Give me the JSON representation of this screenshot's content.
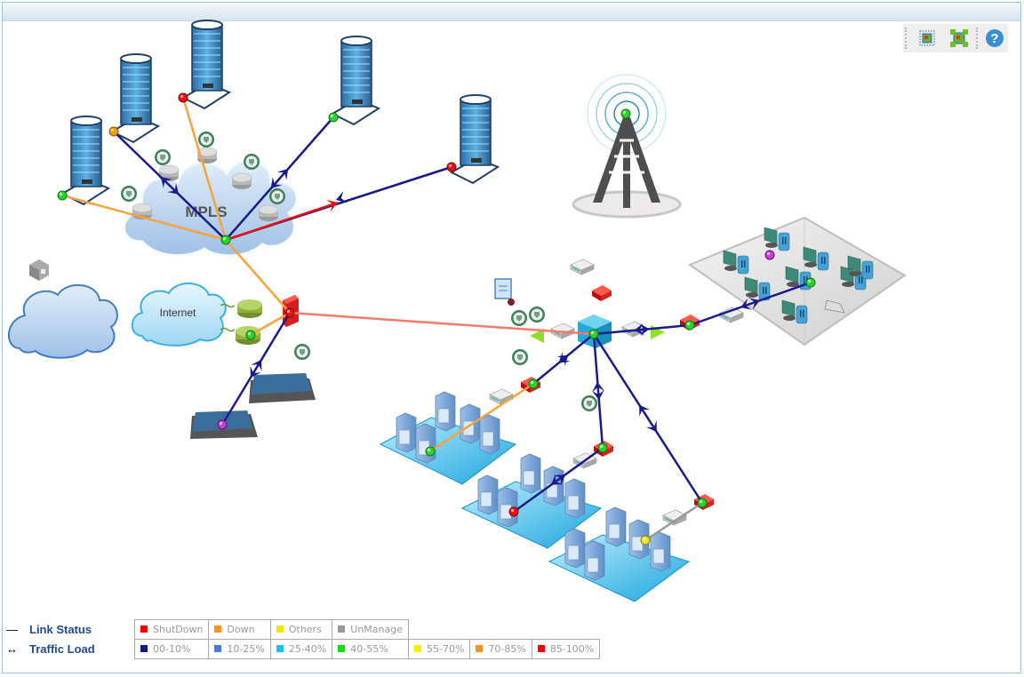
{
  "toolbar": {
    "buttons": [
      {
        "name": "fit-to-view",
        "icon": "fit-view-icon"
      },
      {
        "name": "fullscreen",
        "icon": "expand-view-icon"
      },
      {
        "name": "help",
        "icon": "help-icon",
        "glyph": "?"
      }
    ]
  },
  "map": {
    "clouds": [
      {
        "id": "mpls",
        "label": "MPLS"
      },
      {
        "id": "internet",
        "label": "Internet"
      },
      {
        "id": "unnamed-cloud",
        "label": ""
      }
    ]
  },
  "legend": {
    "link_status": {
      "symbol": "—",
      "label": "Link Status",
      "items": [
        {
          "label": "ShutDown",
          "color": "#ff0000"
        },
        {
          "label": "Down",
          "color": "#f7931e"
        },
        {
          "label": "Others",
          "color": "#f0e800"
        },
        {
          "label": "UnManage",
          "color": "#999999"
        }
      ]
    },
    "traffic_load": {
      "symbol": "↔",
      "label": "Traffic Load",
      "items": [
        {
          "label": "00-10%",
          "color": "#101a8c"
        },
        {
          "label": "10-25%",
          "color": "#4a7bdb"
        },
        {
          "label": "25-40%",
          "color": "#1ec0f0"
        },
        {
          "label": "40-55%",
          "color": "#10e010"
        },
        {
          "label": "55-70%",
          "color": "#f0f000"
        },
        {
          "label": "70-85%",
          "color": "#f7931e"
        },
        {
          "label": "85-100%",
          "color": "#ff0000"
        }
      ]
    }
  },
  "colors": {
    "low_traffic": "#1a1a8c",
    "down": "#f7a23e",
    "high_traffic": "#ee1111",
    "salmon_link": "#f77a6a",
    "unmanaged": "#9a9a9a",
    "status_up": "#22cc22",
    "status_down": "#f39c12",
    "status_shutdown": "#e01010",
    "status_other": "#f0e030",
    "status_purple": "#c040d0"
  }
}
